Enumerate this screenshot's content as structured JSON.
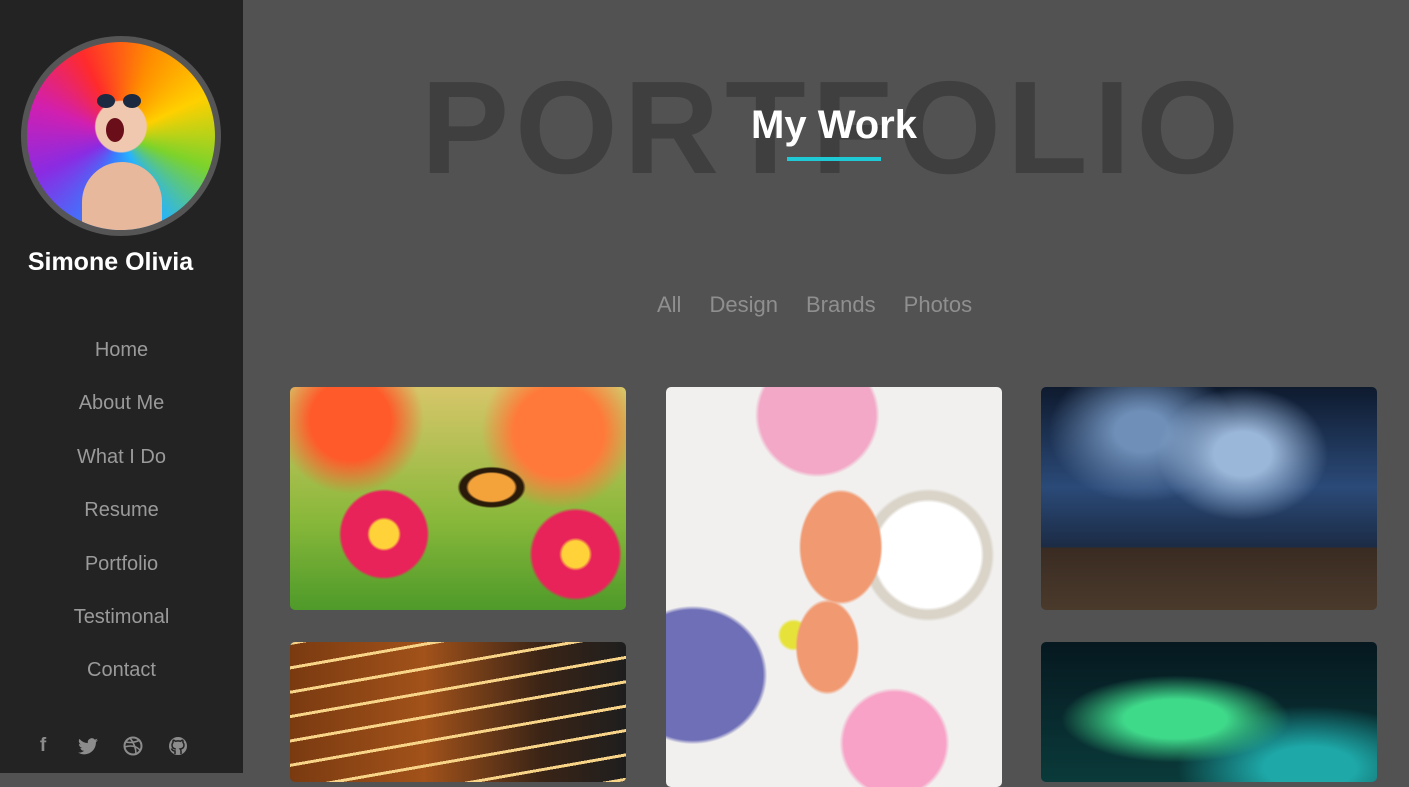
{
  "profile": {
    "name": "Simone Olivia"
  },
  "nav": {
    "items": [
      {
        "label": "Home"
      },
      {
        "label": "About Me"
      },
      {
        "label": "What I Do"
      },
      {
        "label": "Resume"
      },
      {
        "label": "Portfolio"
      },
      {
        "label": "Testimonal"
      },
      {
        "label": "Contact"
      }
    ]
  },
  "social": [
    {
      "icon": "facebook-icon",
      "glyph": "f"
    },
    {
      "icon": "twitter-icon",
      "glyph": "🐦"
    },
    {
      "icon": "dribbble-icon",
      "glyph": "◎"
    },
    {
      "icon": "github-icon",
      "glyph": "◉"
    }
  ],
  "portfolio": {
    "background_word": "PORTFOLIO",
    "title": "My Work",
    "accent_color": "#20c9d6",
    "filters": [
      {
        "label": "All"
      },
      {
        "label": "Design"
      },
      {
        "label": "Brands"
      },
      {
        "label": "Photos"
      }
    ],
    "items": [
      {
        "subject": "butterfly on flowers"
      },
      {
        "subject": "paper cutouts and palette"
      },
      {
        "subject": "stormy sky over road"
      },
      {
        "subject": "carousel lights"
      },
      {
        "subject": "aurora borealis"
      }
    ]
  }
}
